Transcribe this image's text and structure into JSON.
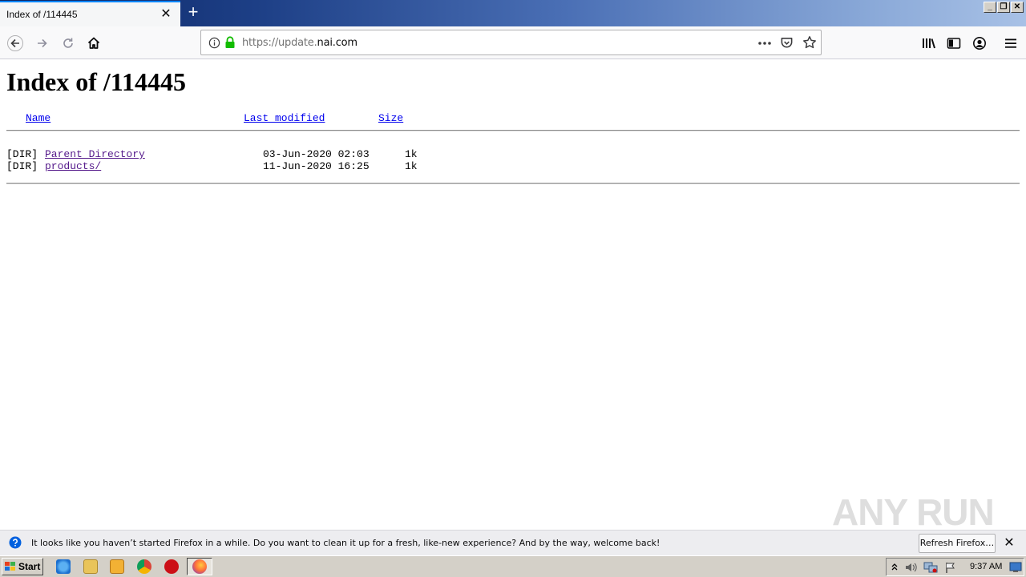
{
  "browser": {
    "tab_title": "Index of /114445",
    "tab_close": "✕",
    "new_tab": "+",
    "url_prefix": "https://update.",
    "url_host": "nai.com",
    "window_buttons": {
      "minimize": "_",
      "restore": "❐",
      "close": "✕"
    }
  },
  "page": {
    "title": "Index of /114445",
    "columns": {
      "name": "Name",
      "last_modified": "Last modified",
      "size": "Size"
    },
    "rows": [
      {
        "type": "[DIR]",
        "name": "Parent Directory",
        "modified": "03-Jun-2020 02:03",
        "size": "1k"
      },
      {
        "type": "[DIR]",
        "name": "products/",
        "modified": "11-Jun-2020 16:25",
        "size": "1k"
      }
    ]
  },
  "notification": {
    "message": "It looks like you haven’t started Firefox in a while. Do you want to clean it up for a fresh, like-new experience? And by the way, welcome back!",
    "button": "Refresh Firefox…",
    "close": "✕"
  },
  "taskbar": {
    "start_label": "Start",
    "clock": "9:37 AM"
  },
  "watermark": "ANY RUN",
  "colors": {
    "link": "#0000ee",
    "visited_link": "#551a8b",
    "accent": "#0a84ff",
    "secure_lock": "#12bc00"
  }
}
